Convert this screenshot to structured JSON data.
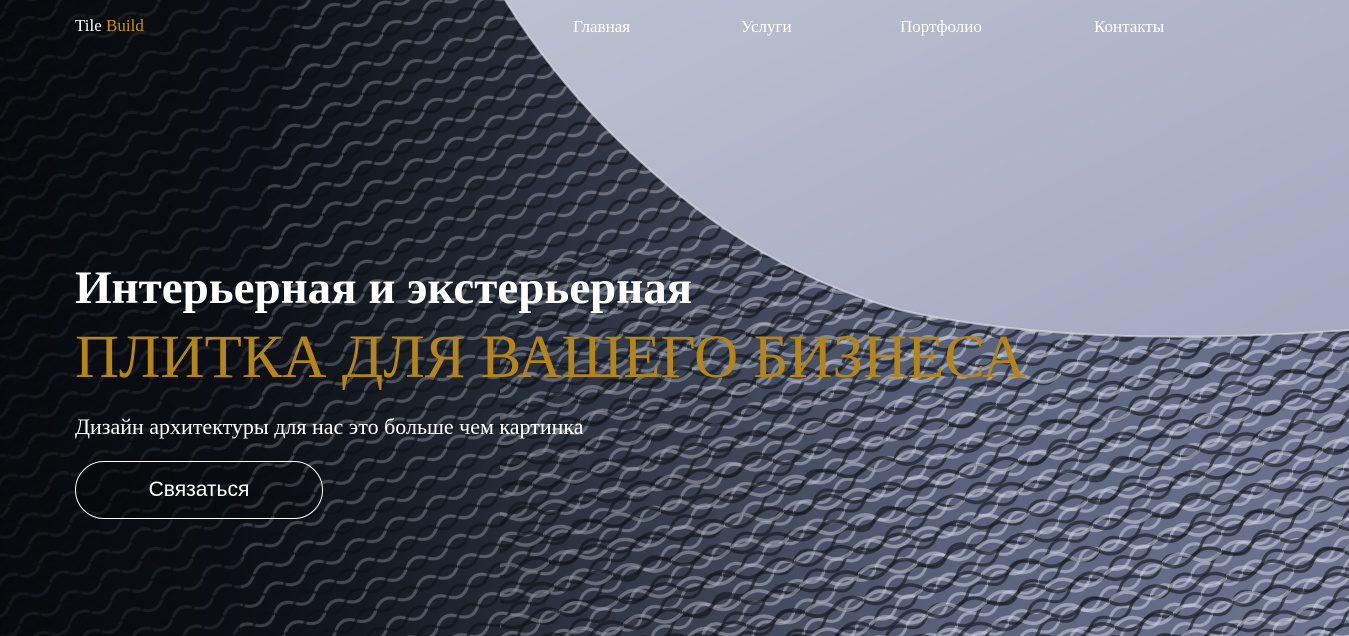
{
  "header": {
    "logo": {
      "part1": "Tile",
      "part2": "Build"
    },
    "nav": [
      {
        "label": "Главная"
      },
      {
        "label": "Услуги"
      },
      {
        "label": "Портфолио"
      },
      {
        "label": "Контакты"
      }
    ]
  },
  "hero": {
    "headline": "Интерьерная и экстерьерная",
    "headline_accent": "ПЛИТКА ДЛЯ ВАШЕГО БИЗНЕСА",
    "subtitle": "Дизайн архитектуры для нас это больше чем картинка",
    "cta_label": "Связаться"
  },
  "colors": {
    "accent": "#c8911a",
    "accent_headline": "#b3851a",
    "text": "#ffffff",
    "sky": "#a9adc2",
    "facade_dark": "#0e1117"
  }
}
